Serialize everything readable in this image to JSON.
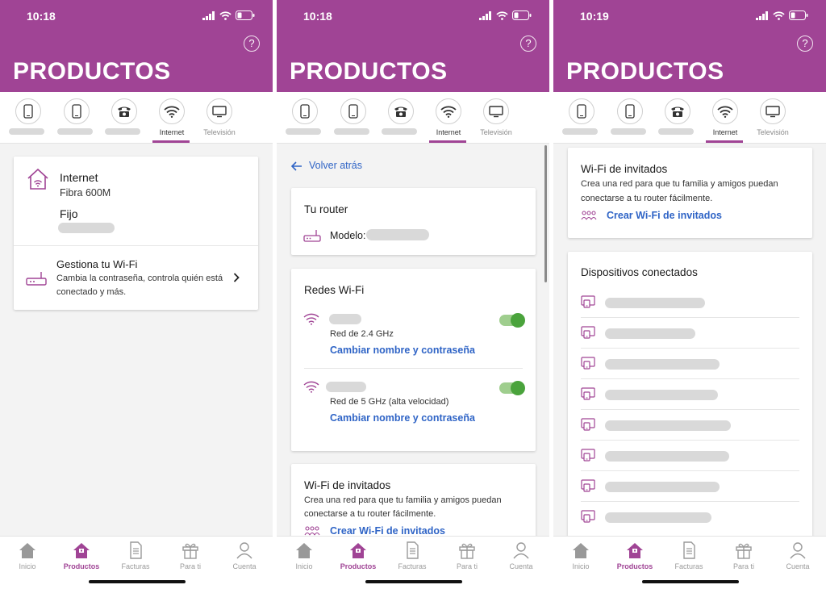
{
  "colors": {
    "brand": "#a04495",
    "link": "#2f64c6",
    "toggle_on": "#4aa33c"
  },
  "screens": [
    {
      "status": {
        "time": "10:18"
      },
      "title": "PRODUCTOS",
      "tabs": {
        "internet": "Internet",
        "tv": "Televisión"
      },
      "internet_card": {
        "heading": "Internet",
        "plan": "Fibra 600M",
        "fixed_label": "Fijo"
      },
      "wifi_manage": {
        "title": "Gestiona tu Wi-Fi",
        "desc_line1": "Cambia la contraseña, controla quién está",
        "desc_line2": "conectado y más."
      }
    },
    {
      "status": {
        "time": "10:18"
      },
      "title": "PRODUCTOS",
      "tabs": {
        "internet": "Internet",
        "tv": "Televisión"
      },
      "back": "Volver atrás",
      "router": {
        "title": "Tu router",
        "model_label": "Modelo:"
      },
      "networks": {
        "title": "Redes Wi-Fi",
        "items": [
          {
            "band": "Red de 2.4 GHz",
            "action": "Cambiar nombre y contraseña",
            "enabled": true
          },
          {
            "band": "Red de 5 GHz (alta velocidad)",
            "action": "Cambiar nombre y contraseña",
            "enabled": true
          }
        ]
      },
      "guest": {
        "title": "Wi-Fi de invitados",
        "desc_line1": "Crea una red para que tu familia y amigos puedan",
        "desc_line2": "conectarse a tu router fácilmente.",
        "action": "Crear Wi-Fi de invitados"
      }
    },
    {
      "status": {
        "time": "10:19"
      },
      "title": "PRODUCTOS",
      "tabs": {
        "internet": "Internet",
        "tv": "Televisión"
      },
      "guest": {
        "title": "Wi-Fi de invitados",
        "desc_line1": "Crea una red para que tu familia y amigos puedan",
        "desc_line2": "conectarse a tu router fácilmente.",
        "action": "Crear Wi-Fi de invitados"
      },
      "devices": {
        "title": "Dispositivos conectados"
      }
    }
  ],
  "nav": {
    "home": "Inicio",
    "products": "Productos",
    "bills": "Facturas",
    "foryou": "Para ti",
    "account": "Cuenta"
  }
}
